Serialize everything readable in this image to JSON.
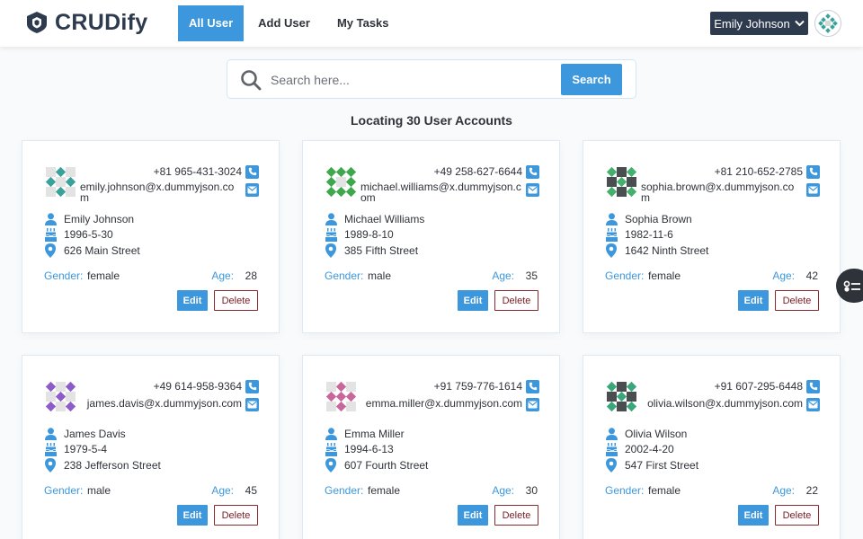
{
  "header": {
    "brand": "CRUDify",
    "nav": [
      {
        "label": "All User",
        "active": true
      },
      {
        "label": "Add User",
        "active": false
      },
      {
        "label": "My Tasks",
        "active": false
      }
    ],
    "user_name": "Emily Johnson",
    "icons": {
      "logo": "shield-logo-icon",
      "dropdown": "chevron-down-icon",
      "avatar": "identicon-avatar"
    }
  },
  "search": {
    "placeholder": "Search here...",
    "button_label": "Search",
    "icon": "search-icon"
  },
  "results_title": "Locating 30 User Accounts",
  "labels": {
    "gender": "Gender:",
    "age": "Age:",
    "edit": "Edit",
    "delete": "Delete"
  },
  "colors": {
    "accent": "#3c97dc",
    "dark": "#2e3a4d",
    "delete": "#7a1e23"
  },
  "users": [
    {
      "name": "Emily Johnson",
      "phone": "+81 965-431-3024",
      "email": "emily.johnson@x.dummyjson.com",
      "birth": "1996-5-30",
      "address": "626 Main Street",
      "gender": "female",
      "age": "28",
      "avatar_color": "#3aa29a"
    },
    {
      "name": "Michael Williams",
      "phone": "+49 258-627-6644",
      "email": "michael.williams@x.dummyjson.com",
      "birth": "1989-8-10",
      "address": "385 Fifth Street",
      "gender": "male",
      "age": "35",
      "avatar_color": "#3fa74e"
    },
    {
      "name": "Sophia Brown",
      "phone": "+81 210-652-2785",
      "email": "sophia.brown@x.dummyjson.com",
      "birth": "1982-11-6",
      "address": "1642 Ninth Street",
      "gender": "female",
      "age": "42",
      "avatar_color": "#45b06d"
    },
    {
      "name": "James Davis",
      "phone": "+49 614-958-9364",
      "email": "james.davis@x.dummyjson.com",
      "birth": "1979-5-4",
      "address": "238 Jefferson Street",
      "gender": "male",
      "age": "45",
      "avatar_color": "#8d5cc9"
    },
    {
      "name": "Emma Miller",
      "phone": "+91 759-776-1614",
      "email": "emma.miller@x.dummyjson.com",
      "birth": "1994-6-13",
      "address": "607 Fourth Street",
      "gender": "female",
      "age": "30",
      "avatar_color": "#c8679a"
    },
    {
      "name": "Olivia Wilson",
      "phone": "+91 607-295-6448",
      "email": "olivia.wilson@x.dummyjson.com",
      "birth": "2002-4-20",
      "address": "547 First Street",
      "gender": "female",
      "age": "22",
      "avatar_color": "#39a77a"
    }
  ]
}
